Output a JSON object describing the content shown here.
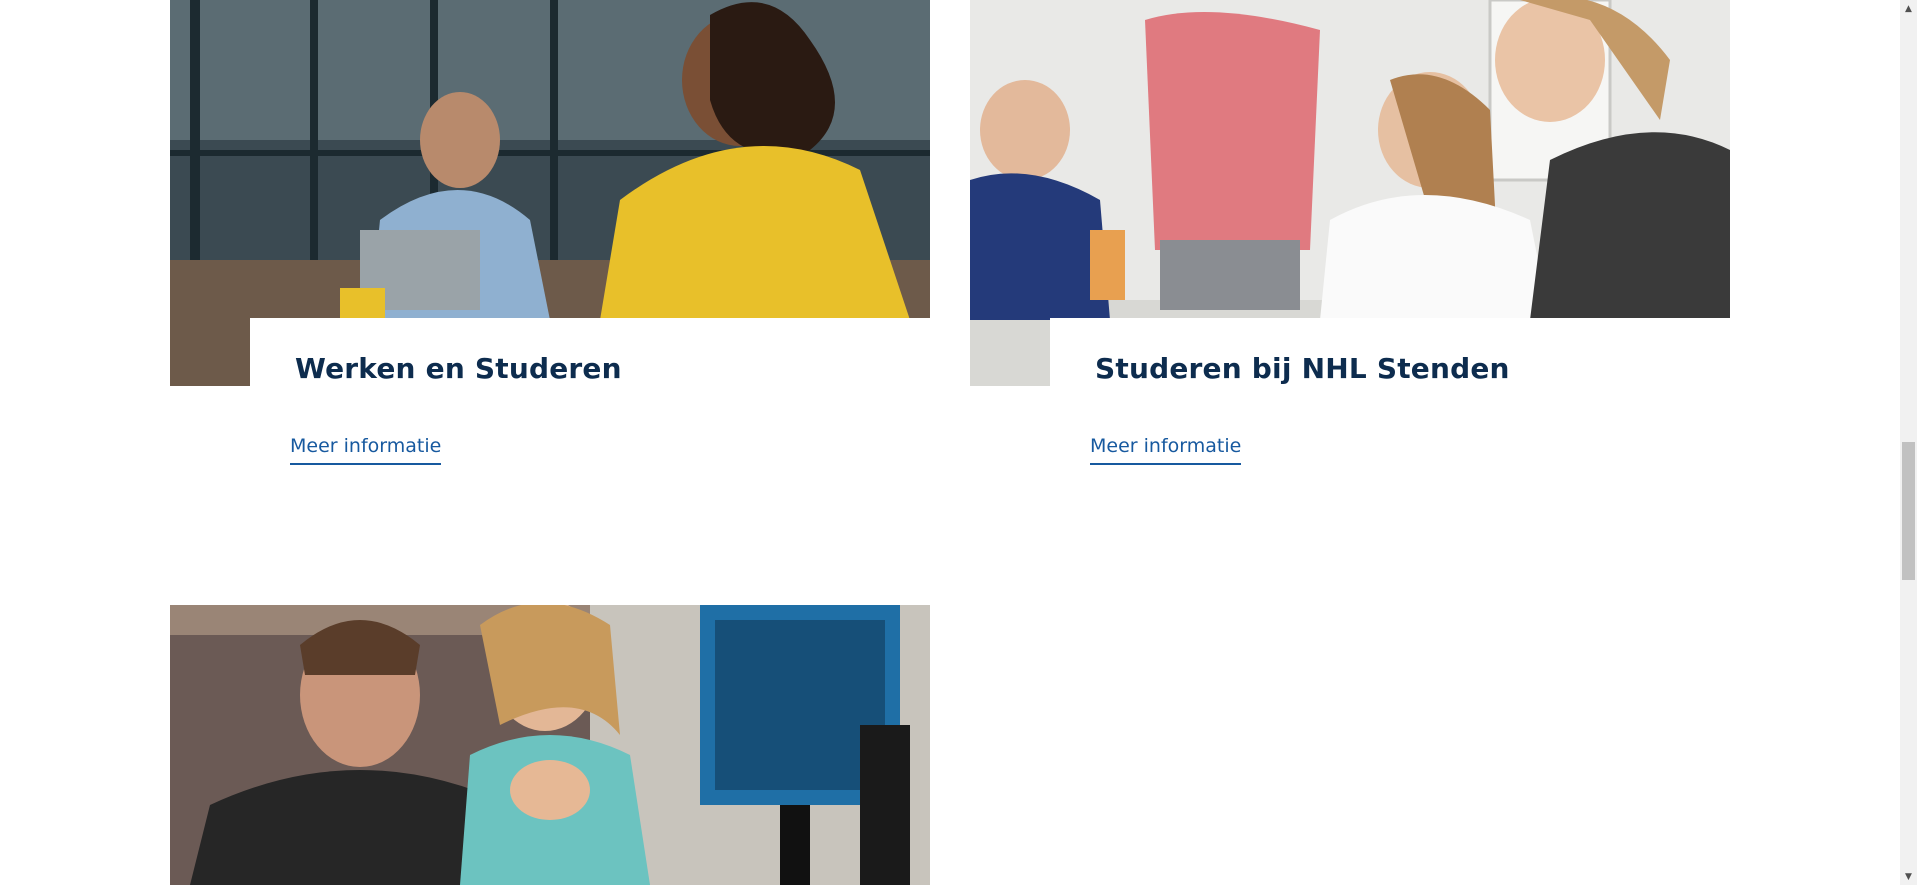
{
  "cards": [
    {
      "title": "Werken en Studeren",
      "link_label": "Meer informatie",
      "image_description": "photo-office-headset"
    },
    {
      "title": "Studeren bij NHL Stenden",
      "link_label": "Meer informatie",
      "image_description": "photo-students-table"
    },
    {
      "image_description": "photo-students-monitor"
    }
  ],
  "colors": {
    "title": "#0d2c4e",
    "link": "#17599f",
    "background": "#ffffff"
  },
  "scrollbar": {
    "up_arrow": "▲",
    "down_arrow": "▼"
  }
}
